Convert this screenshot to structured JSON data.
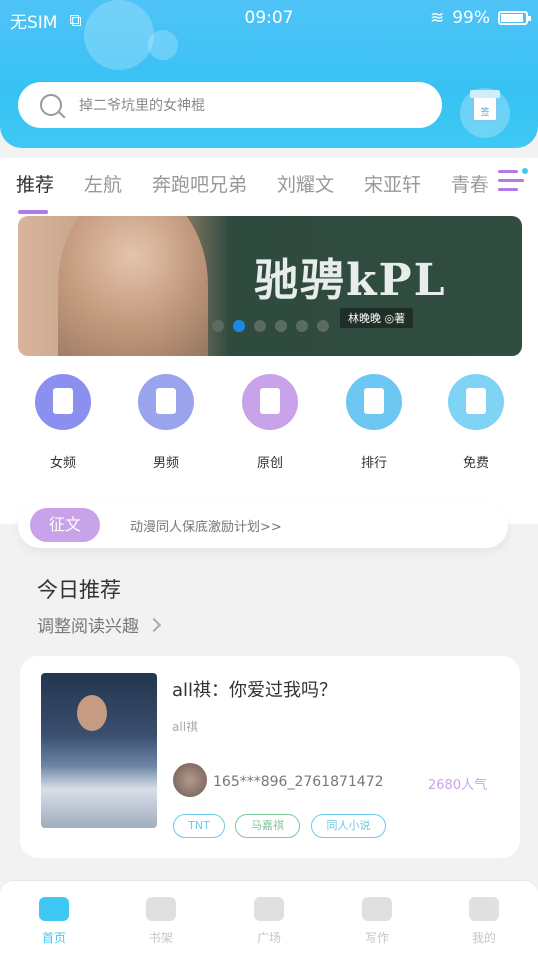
{
  "status": {
    "carrier": "无SIM",
    "time": "09:07",
    "battery": "99%"
  },
  "search": {
    "placeholder": "掉二爷坑里的女神棍"
  },
  "gift": {
    "label": "签"
  },
  "tabs": [
    {
      "label": "推荐"
    },
    {
      "label": "左航"
    },
    {
      "label": "奔跑吧兄弟"
    },
    {
      "label": "刘耀文"
    },
    {
      "label": "宋亚轩"
    },
    {
      "label": "青春"
    }
  ],
  "banner": {
    "title": "驰骋kPL",
    "author": "林晚晚 ◎著",
    "page_count": 6,
    "active_page": 2
  },
  "categories": [
    {
      "label": "女频",
      "icon": "dress-icon",
      "color": "#8a8ff0"
    },
    {
      "label": "男频",
      "icon": "shirt-icon",
      "color": "#9aa3ee"
    },
    {
      "label": "原创",
      "icon": "book-icon",
      "color": "#c9a3ea"
    },
    {
      "label": "排行",
      "icon": "trophy-icon",
      "color": "#6cc7f3"
    },
    {
      "label": "免费",
      "icon": "coin-icon",
      "color": "#7fd3f5"
    }
  ],
  "notice": {
    "tag": "征文",
    "text": "动漫同人保底激励计划>>"
  },
  "recommend": {
    "title": "今日推荐",
    "subtitle": "调整阅读兴趣"
  },
  "book": {
    "title": "all祺：你爱过我吗？",
    "subtitle": "all祺",
    "author": "165***896_2761871472",
    "popularity": "2680人气",
    "tags": [
      {
        "label": "TNT",
        "color": "#6ccbe8"
      },
      {
        "label": "马嘉祺",
        "color": "#7cc89a"
      },
      {
        "label": "同人小说",
        "color": "#6ccbe8"
      }
    ]
  },
  "nav": [
    {
      "label": "首页",
      "icon": "home-icon"
    },
    {
      "label": "书架",
      "icon": "bookshelf-icon"
    },
    {
      "label": "广场",
      "icon": "planet-icon"
    },
    {
      "label": "写作",
      "icon": "pen-icon"
    },
    {
      "label": "我的",
      "icon": "chat-icon"
    }
  ]
}
